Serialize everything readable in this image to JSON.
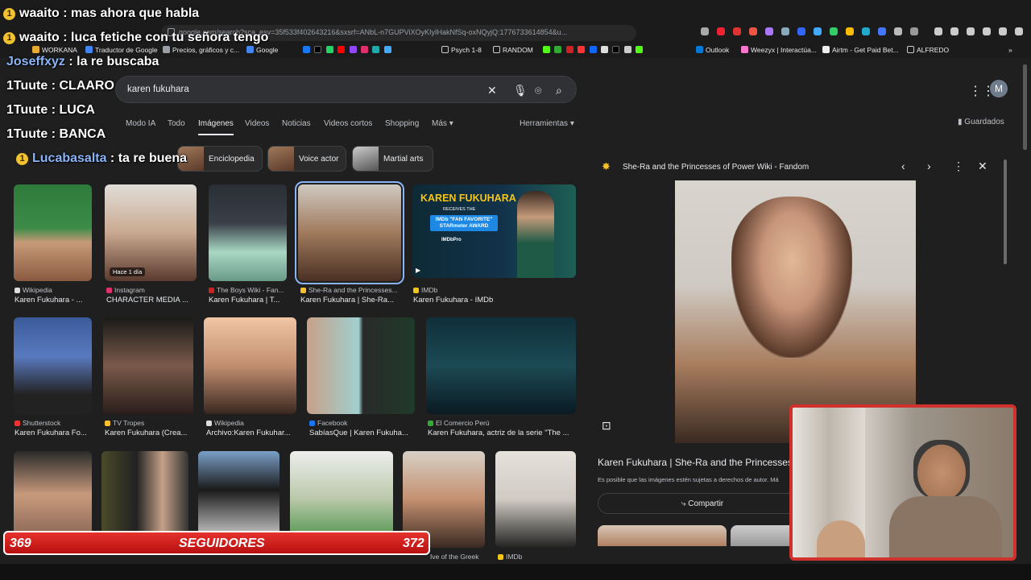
{
  "browser": {
    "url": "google.com/search?sca_esv=35f533f402643216&sxsrf=ANbL-n7GUPViXOyKIyIHakNfSq-oxNQyjQ:1776733614854&u...",
    "bookmarks": [
      "WORKANA",
      "Traductor de Google",
      "Precios, gráficos y c...",
      "Google",
      "Psych 1-8",
      "RANDOM",
      "Outlook",
      "Weezyx | Interactúa...",
      "Airtm - Get Paid Bet...",
      "ALFREDO"
    ]
  },
  "google": {
    "query": "karen fukuhara",
    "tabs": [
      "Modo IA",
      "Todo",
      "Imágenes",
      "Videos",
      "Noticias",
      "Videos cortos",
      "Shopping",
      "Más"
    ],
    "tools": "Herramientas",
    "saved": "Guardados",
    "avatar_letter": "M",
    "chips": [
      "Enciclopedia",
      "Voice actor",
      "Martial arts"
    ],
    "results_row1": [
      {
        "source": "Wikipedia",
        "title": "Karen Fukuhara - ..."
      },
      {
        "source": "Instagram",
        "title": "CHARACTER MEDIA ...",
        "badge": "Hace 1 día"
      },
      {
        "source": "The Boys Wiki - Fan...",
        "title": "Karen Fukuhara | T..."
      },
      {
        "source": "She-Ra and the Princesses...",
        "title": "Karen Fukuhara | She-Ra..."
      },
      {
        "source": "IMDb",
        "title": "Karen Fukuhara - IMDb"
      }
    ],
    "results_row2": [
      {
        "source": "Shutterstock",
        "title": "Karen Fukuhara Fo..."
      },
      {
        "source": "TV Tropes",
        "title": "Karen Fukuhara (Crea..."
      },
      {
        "source": "Wikipedia",
        "title": "Archivo:Karen Fukuhar..."
      },
      {
        "source": "Facebook",
        "title": "SabíasQue | Karen Fukuha..."
      },
      {
        "source": "El Comercio Perú",
        "title": "Karen Fukuhara, actriz de la serie \"The ..."
      }
    ],
    "row3_captions": [
      "Ive of the Greek",
      "IMDb"
    ],
    "imdb_banner": {
      "name": "KAREN FUKUHARA",
      "line1": "RECEIVES THE",
      "line2": "IMDb \"FAN FAVORITE\" STARmeter AWARD",
      "brand": "IMDbPro"
    },
    "panel": {
      "source": "She-Ra and the Princesses of Power Wiki - Fandom",
      "title": "Karen Fukuhara | She-Ra and the Princesses",
      "copyright": "Es posible que las imágenes estén sujetas a derechos de autor. Má",
      "share": "Compartir"
    }
  },
  "chat": [
    {
      "user": "waaito",
      "msg": "mas ahora que habla",
      "badge": "1"
    },
    {
      "user": "waaito",
      "msg": "luca fetiche con tu señora tengo",
      "badge": "1"
    },
    {
      "user": "Joseffxyz",
      "msg": "la re buscaba"
    },
    {
      "user": "1Tuute",
      "msg": "CLAARO"
    },
    {
      "user": "1Tuute",
      "msg": "LUCA"
    },
    {
      "user": "1Tuute",
      "msg": "BANCA"
    },
    {
      "user": "Lucabasalta",
      "msg": "ta re buena",
      "badge": "1"
    }
  ],
  "followers": {
    "current": "369",
    "label": "SEGUIDORES",
    "goal": "372"
  }
}
